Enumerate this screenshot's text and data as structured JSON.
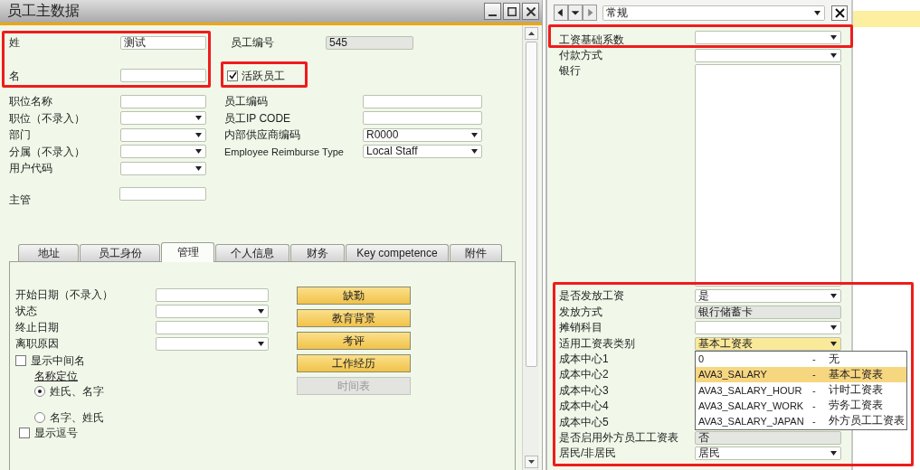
{
  "main_window": {
    "title": "员工主数据",
    "last_name": {
      "label": "姓",
      "kind": "input",
      "value": "测试"
    },
    "first_name": {
      "label": "名",
      "kind": "input"
    },
    "employee_no": {
      "label": "员工编号",
      "kind": "readonly",
      "value": "545"
    },
    "active": {
      "label": "活跃员工",
      "checked": true
    },
    "left_fields": [
      {
        "label": "职位名称",
        "kind": "input"
      },
      {
        "label": "职位（不录入）",
        "kind": "dropdown"
      },
      {
        "label": "部门",
        "kind": "dropdown"
      },
      {
        "label": "分属（不录入）",
        "kind": "dropdown"
      },
      {
        "label": "用户代码",
        "kind": "dropdown"
      }
    ],
    "right_fields": [
      {
        "label": "员工编码",
        "kind": "input"
      },
      {
        "label": "员工IP CODE",
        "kind": "input"
      },
      {
        "label": "内部供应商编码",
        "kind": "dropdown",
        "value": "R0000"
      },
      {
        "label": "Employee Reimburse Type",
        "kind": "dropdown",
        "value": "Local Staff"
      }
    ],
    "manager": {
      "label": "主管",
      "kind": "input"
    },
    "tabs": [
      {
        "label": "地址",
        "selected": false
      },
      {
        "label": "员工身份",
        "selected": false
      },
      {
        "label": "管理",
        "selected": true
      },
      {
        "label": "个人信息",
        "selected": false
      },
      {
        "label": "财务",
        "selected": false
      },
      {
        "label": "Key competence",
        "selected": false
      },
      {
        "label": "附件",
        "selected": false
      }
    ],
    "admin_fields": [
      {
        "label": "开始日期（不录入）",
        "kind": "input"
      },
      {
        "label": "状态",
        "kind": "dropdown"
      },
      {
        "label": "终止日期",
        "kind": "input"
      },
      {
        "label": "离职原因",
        "kind": "dropdown"
      }
    ],
    "admin_buttons": [
      {
        "label": "缺勤",
        "disabled": false
      },
      {
        "label": "教育背景",
        "disabled": false
      },
      {
        "label": "考评",
        "disabled": false
      },
      {
        "label": "工作经历",
        "disabled": false
      },
      {
        "label": "时间表",
        "disabled": true
      }
    ],
    "show_middle_name": {
      "label": "显示中间名",
      "checked": false
    },
    "name_order": {
      "title": "名称定位",
      "options": [
        {
          "label": "姓氏、名字",
          "selected": true
        },
        {
          "label": "名字、姓氏",
          "selected": false
        }
      ]
    },
    "show_comma": {
      "label": "显示逗号",
      "checked": false
    }
  },
  "side_panel": {
    "view": {
      "value": "常规"
    },
    "fields": [
      {
        "label": "工资基础系数",
        "kind": "dropdown",
        "focused": false
      },
      {
        "label": "付款方式",
        "kind": "dropdown",
        "focused": false
      },
      {
        "label": "银行",
        "kind": "textarea",
        "focused": false
      },
      {
        "label": "是否发放工资",
        "kind": "dropdown",
        "value": "是",
        "focused": false
      },
      {
        "label": "发放方式",
        "kind": "readonly",
        "value": "银行储蓄卡",
        "focused": false
      },
      {
        "label": "摊销科目",
        "kind": "dropdown",
        "focused": false
      },
      {
        "label": "适用工资表类别",
        "kind": "dropdown",
        "value": "基本工资表",
        "focused": true
      },
      {
        "label": "成本中心1",
        "kind": "covered"
      },
      {
        "label": "成本中心2",
        "kind": "covered"
      },
      {
        "label": "成本中心3",
        "kind": "covered"
      },
      {
        "label": "成本中心4",
        "kind": "covered"
      },
      {
        "label": "成本中心5",
        "kind": "covered"
      },
      {
        "label": "是否启用外方员工工资表",
        "kind": "readonly",
        "value": "否",
        "focused": false
      },
      {
        "label": "居民/非居民",
        "kind": "dropdown",
        "value": "居民",
        "focused": false
      }
    ],
    "dropdown_list": [
      {
        "code": "0",
        "separator": "-",
        "name": "无",
        "selected": false
      },
      {
        "code": "AVA3_SALARY",
        "separator": "-",
        "name": "基本工资表",
        "selected": true
      },
      {
        "code": "AVA3_SALARY_HOUR",
        "separator": "-",
        "name": "计时工资表",
        "selected": false
      },
      {
        "code": "AVA3_SALARY_WORK",
        "separator": "-",
        "name": "劳务工资表",
        "selected": false
      },
      {
        "code": "AVA3_SALARY_JAPAN",
        "separator": "-",
        "name": "外方员工工资表",
        "selected": false
      }
    ]
  }
}
